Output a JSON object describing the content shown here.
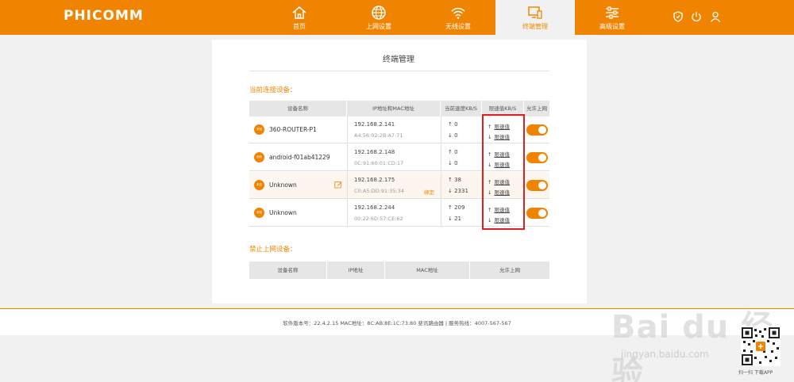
{
  "header": {
    "logo": "PHICOMM",
    "nav": [
      {
        "label": "首页",
        "icon": "home-icon"
      },
      {
        "label": "上网设置",
        "icon": "globe-icon"
      },
      {
        "label": "无线设置",
        "icon": "wifi-icon"
      },
      {
        "label": "终端管理",
        "icon": "monitor-icon",
        "active": true
      },
      {
        "label": "高级设置",
        "icon": "sliders-icon"
      }
    ],
    "right_icons": [
      "shield-icon",
      "power-icon",
      "user-icon"
    ]
  },
  "main": {
    "title": "终端管理",
    "connected_section": "当前连接设备：",
    "columns": [
      "设备名称",
      "IP地址和MAC地址",
      "当前速度KB/S",
      "限速值KB/S",
      "允许上网"
    ],
    "devices": [
      {
        "badge": "未知",
        "name": "360-ROUTER-P1",
        "ip": "192.168.2.141",
        "mac": "A4:56:02:2B:A7:71",
        "up": "↑ 0",
        "down": "↓ 0",
        "limit_up": "↑",
        "limit_down": "↓",
        "limit_link": "限速值",
        "bind": "",
        "editable": false
      },
      {
        "badge": "未知",
        "name": "android-f01ab41229",
        "ip": "192.168.2.148",
        "mac": "0C:91:60:01:CD:17",
        "up": "↑ 0",
        "down": "↓ 0",
        "limit_up": "↑",
        "limit_down": "↓",
        "limit_link": "限速值",
        "bind": "",
        "editable": false
      },
      {
        "badge": "本机",
        "name": "Unknown",
        "ip": "192.168.2.175",
        "mac": "C0:A5:DD:91:35:34",
        "up": "↑ 38",
        "down": "↓ 2331",
        "limit_up": "↑",
        "limit_down": "↓",
        "limit_link": "限速值",
        "bind": "绑定",
        "editable": true
      },
      {
        "badge": "未知",
        "name": "Unknown",
        "ip": "192.168.2.244",
        "mac": "00:22:6D:57:CE:62",
        "up": "↑ 209",
        "down": "↓ 21",
        "limit_up": "↑",
        "limit_down": "↓",
        "limit_link": "限速值",
        "bind": "",
        "editable": false
      }
    ],
    "blocked_section": "禁止上网设备：",
    "blocked_columns": [
      "设备名称",
      "IP地址",
      "MAC地址",
      "允许上网"
    ]
  },
  "footer": {
    "text": "软件版本号：22.4.2.15    MAC地址：8C:AB:8E:1C:73:80    斐讯路由器 | 服务热线：4007-567-567"
  },
  "watermark": {
    "brand": "Bai du 经验",
    "url": "jingyan.baidu.com",
    "qr_label": "扫一扫 下载APP"
  },
  "colors": {
    "accent": "#f08400",
    "highlight_box": "#e02020"
  }
}
